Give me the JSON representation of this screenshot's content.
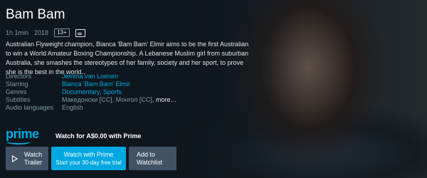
{
  "title": "Bam Bam",
  "meta": {
    "duration": "1h 1min",
    "year": "2018",
    "rating": "13+",
    "subtitles_icon": "cc-icon"
  },
  "synopsis": "Australian Flyweight champion, Bianca 'Bam Bam' Elmir aims to be the first Australian to win a World Amateur Boxing Championship. A Lebanese Muslim girl from suburban Australia, she smashes the stereotypes of her family, society and her sport, to prove she is the best in the world..",
  "details": {
    "directors_label": "Directors",
    "directors": "Jemma van Loenen",
    "starring_label": "Starring",
    "starring": "Bianca 'Bam Bam' Elmir",
    "genres_label": "Genres",
    "genres": "Documentary, Sports",
    "subtitles_label": "Subtitles",
    "subtitles": "Македонски [CC], Монгол [CC],",
    "subtitles_more": "more…",
    "audio_label": "Audio languages",
    "audio": "English"
  },
  "prime": {
    "logo_text": "prime",
    "watch_for": "Watch for A$0.00 with Prime"
  },
  "buttons": {
    "trailer_line1": "Watch",
    "trailer_line2": "Trailer",
    "prime_line1": "Watch with Prime",
    "prime_line2": "Start your 30-day free trial",
    "watchlist_line1": "Add to",
    "watchlist_line2": "Watchlist"
  },
  "colors": {
    "accent": "#00a8e1",
    "background": "#0f171e",
    "secondary_button": "#425265",
    "muted_text": "#8197a4"
  }
}
